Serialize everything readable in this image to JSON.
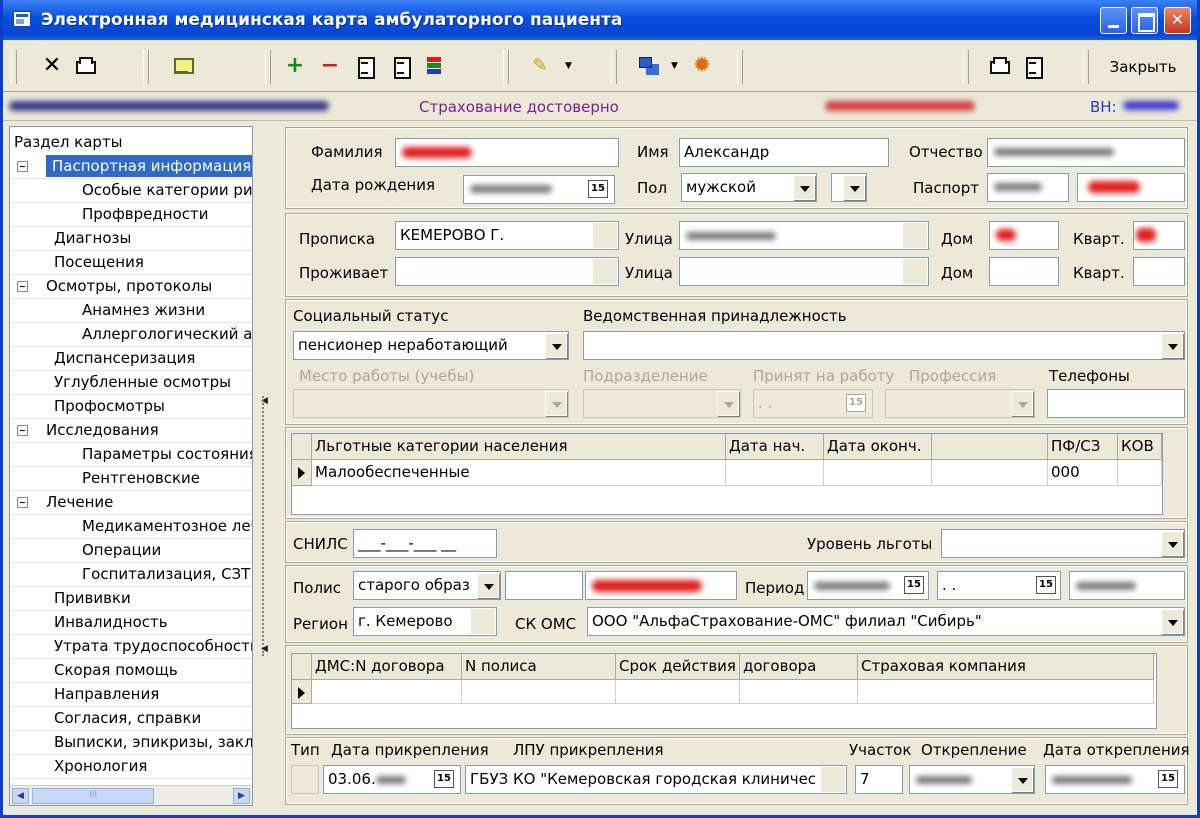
{
  "window": {
    "title": "Электронная медицинская карта амбулаторного пациента"
  },
  "toolbar": {
    "close_label": "Закрыть"
  },
  "infostrip": {
    "insurance_status": "Страхование достоверно",
    "vn_label": "ВН:"
  },
  "tree": {
    "header": "Раздел карты",
    "items": [
      {
        "label": "Паспортная информация",
        "level": 0,
        "expander": true,
        "selected": true
      },
      {
        "label": "Особые категории ри",
        "level": 2
      },
      {
        "label": "Профвредности",
        "level": 2
      },
      {
        "label": "Диагнозы",
        "level": 1
      },
      {
        "label": "Посещения",
        "level": 1
      },
      {
        "label": "Осмотры, протоколы",
        "level": 0,
        "expander": true
      },
      {
        "label": "Анамнез жизни",
        "level": 2
      },
      {
        "label": "Аллергологический ан",
        "level": 2
      },
      {
        "label": "Диспансеризация",
        "level": 1
      },
      {
        "label": "Углубленные осмотры",
        "level": 1
      },
      {
        "label": "Профосмотры",
        "level": 1
      },
      {
        "label": "Исследования",
        "level": 0,
        "expander": true
      },
      {
        "label": "Параметры состояния",
        "level": 2
      },
      {
        "label": "Рентгеновские",
        "level": 2
      },
      {
        "label": "Лечение",
        "level": 0,
        "expander": true
      },
      {
        "label": "Медикаментозное леч",
        "level": 2
      },
      {
        "label": "Операции",
        "level": 2
      },
      {
        "label": "Госпитализация, СЗТ",
        "level": 2
      },
      {
        "label": "Прививки",
        "level": 1
      },
      {
        "label": "Инвалидность",
        "level": 1
      },
      {
        "label": "Утрата трудоспособности",
        "level": 1
      },
      {
        "label": "Скорая помощь",
        "level": 1
      },
      {
        "label": "Направления",
        "level": 1
      },
      {
        "label": "Согласия, справки",
        "level": 1
      },
      {
        "label": "Выписки, эпикризы, закл",
        "level": 1
      },
      {
        "label": "Хронология",
        "level": 1
      }
    ]
  },
  "passport": {
    "surname_label": "Фамилия",
    "name_label": "Имя",
    "name_value": "Александр",
    "patronymic_label": "Отчество",
    "birthdate_label": "Дата рождения",
    "sex_label": "Пол",
    "sex_value": "мужской",
    "passport_label": "Паспорт",
    "cal_glyph": "15"
  },
  "address": {
    "reg_label": "Прописка",
    "reg_city": "КЕМЕРОВО Г.",
    "street_label": "Улица",
    "house_label": "Дом",
    "flat_label": "Кварт.",
    "live_label": "Проживает"
  },
  "social": {
    "status_label": "Социальный статус",
    "status_value": "пенсионер неработающий",
    "dept_label": "Ведомственная принадлежность",
    "work_label": "Место работы (учебы)",
    "division_label": "Подразделение",
    "hired_label": "Принят на работу",
    "hired_value": ". .",
    "profession_label": "Профессия",
    "phones_label": "Телефоны"
  },
  "benefits_grid": {
    "columns": [
      "Льготные категории населения",
      "Дата нач.",
      "Дата оконч.",
      "",
      "ПФ/СЗ",
      "КОВ"
    ],
    "rows": [
      [
        "Малообеспеченные",
        "",
        "",
        "",
        "000",
        ""
      ]
    ]
  },
  "snils": {
    "label": "СНИЛС",
    "value": "___-___-___ __",
    "level_label": "Уровень льготы"
  },
  "policy": {
    "label": "Полис",
    "type_value": "старого образ",
    "period_label": "Период",
    "period_to": ". .",
    "region_label": "Регион",
    "region_value": "г. Кемерово",
    "skoms_label": "СК ОМС",
    "skoms_value": "ООО  \"АльфаСтрахование-ОМС\" филиал \"Сибирь\""
  },
  "dms_grid": {
    "columns": [
      "ДМС:N договора",
      "N полиса",
      "Срок действия",
      "договора",
      "Страховая компания"
    ]
  },
  "attachment": {
    "type_label": "Тип",
    "date_label": "Дата прикрепления",
    "date_value": "03.06.",
    "lpu_label": "ЛПУ прикрепления",
    "lpu_value": "ГБУЗ КО \"Кемеровская городская клиничес",
    "section_label": "Участок",
    "section_value": "7",
    "detach_label": "Открепление",
    "detach_date_label": "Дата открепления"
  }
}
